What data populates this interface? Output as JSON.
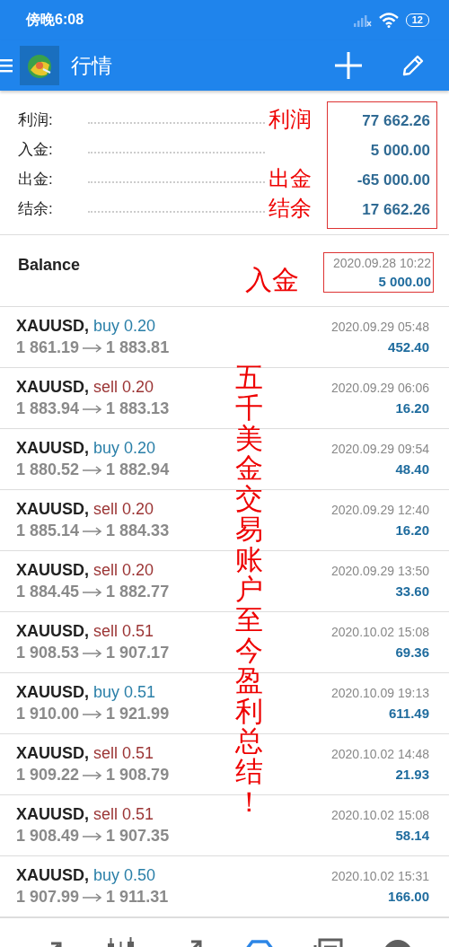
{
  "status_bar": {
    "time": "傍晚6:08",
    "battery": "12"
  },
  "toolbar": {
    "title": "行情"
  },
  "summary": {
    "highlighted": true,
    "rows": [
      {
        "label": "利润:",
        "value": "77 662.26",
        "annotation": "利润"
      },
      {
        "label": "入金:",
        "value": "5 000.00"
      },
      {
        "label": "出金:",
        "value": "-65 000.00",
        "annotation": "出金"
      },
      {
        "label": "结余:",
        "value": "17 662.26",
        "annotation": "结余"
      }
    ]
  },
  "balance": {
    "label": "Balance",
    "time": "2020.09.28 10:22",
    "amount": "5 000.00",
    "annotation": "入金",
    "highlighted": true
  },
  "trades": [
    {
      "symbol": "XAUUSD,",
      "kind": "buy",
      "order": "buy 0.20",
      "open": "1 861.19",
      "close": "1 883.81",
      "time": "2020.09.29 05:48",
      "profit": "452.40"
    },
    {
      "symbol": "XAUUSD,",
      "kind": "sell",
      "order": "sell 0.20",
      "open": "1 883.94",
      "close": "1 883.13",
      "time": "2020.09.29 06:06",
      "profit": "16.20"
    },
    {
      "symbol": "XAUUSD,",
      "kind": "buy",
      "order": "buy 0.20",
      "open": "1 880.52",
      "close": "1 882.94",
      "time": "2020.09.29 09:54",
      "profit": "48.40"
    },
    {
      "symbol": "XAUUSD,",
      "kind": "sell",
      "order": "sell 0.20",
      "open": "1 885.14",
      "close": "1 884.33",
      "time": "2020.09.29 12:40",
      "profit": "16.20"
    },
    {
      "symbol": "XAUUSD,",
      "kind": "sell",
      "order": "sell 0.20",
      "open": "1 884.45",
      "close": "1 882.77",
      "time": "2020.09.29 13:50",
      "profit": "33.60"
    },
    {
      "symbol": "XAUUSD,",
      "kind": "sell",
      "order": "sell 0.51",
      "open": "1 908.53",
      "close": "1 907.17",
      "time": "2020.10.02 15:08",
      "profit": "69.36"
    },
    {
      "symbol": "XAUUSD,",
      "kind": "buy",
      "order": "buy 0.51",
      "open": "1 910.00",
      "close": "1 921.99",
      "time": "2020.10.09 19:13",
      "profit": "611.49"
    },
    {
      "symbol": "XAUUSD,",
      "kind": "sell",
      "order": "sell 0.51",
      "open": "1 909.22",
      "close": "1 908.79",
      "time": "2020.10.02 14:48",
      "profit": "21.93"
    },
    {
      "symbol": "XAUUSD,",
      "kind": "sell",
      "order": "sell 0.51",
      "open": "1 908.49",
      "close": "1 907.35",
      "time": "2020.10.02 15:08",
      "profit": "58.14"
    },
    {
      "symbol": "XAUUSD,",
      "kind": "buy",
      "order": "buy 0.50",
      "open": "1 907.99",
      "close": "1 911.31",
      "time": "2020.10.02 15:31",
      "profit": "166.00"
    }
  ],
  "annotation_note": "五千美金交易账户至今盈利总结！",
  "bottom_nav": [
    {
      "kind": "quotes",
      "selected": false
    },
    {
      "kind": "chart",
      "selected": false
    },
    {
      "kind": "trend",
      "selected": false
    },
    {
      "kind": "trade",
      "selected": true
    },
    {
      "kind": "news",
      "selected": false
    },
    {
      "kind": "more",
      "selected": false
    }
  ]
}
